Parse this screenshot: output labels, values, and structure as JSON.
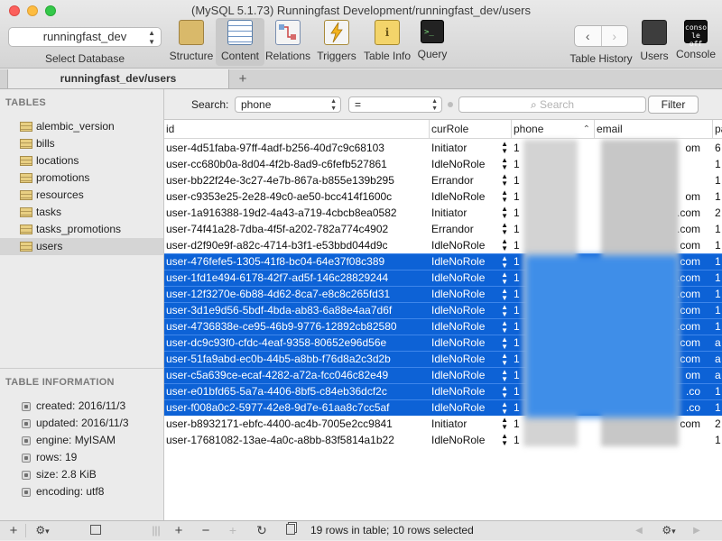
{
  "window": {
    "title": "(MySQL 5.1.73) Runningfast Development/runningfast_dev/users"
  },
  "toolbar": {
    "database": "runningfast_dev",
    "database_label": "Select Database",
    "structure": "Structure",
    "content": "Content",
    "relations": "Relations",
    "triggers": "Triggers",
    "table_info": "Table Info",
    "query": "Query",
    "table_history": "Table History",
    "users": "Users",
    "console": "Console",
    "console_icon_text": "conso le off",
    "query_icon_text": ">_"
  },
  "tab": {
    "label": "runningfast_dev/users",
    "add": "+"
  },
  "sidebar": {
    "tables_header": "TABLES",
    "tables": [
      "alembic_version",
      "bills",
      "locations",
      "promotions",
      "resources",
      "tasks",
      "tasks_promotions",
      "users"
    ],
    "info_header": "TABLE INFORMATION",
    "info": [
      "created: 2016/11/3",
      "updated: 2016/11/3",
      "engine: MyISAM",
      "rows: 19",
      "size: 2.8 KiB",
      "encoding: utf8"
    ]
  },
  "filter": {
    "search_label": "Search:",
    "field": "phone",
    "operator": "=",
    "search_placeholder": "Search",
    "filter_button": "Filter"
  },
  "table": {
    "columns": [
      "id",
      "curRole",
      "phone",
      "email",
      "pa"
    ],
    "rows": [
      {
        "id": "user-4d51faba-97ff-4adf-b256-40d7c9c68103",
        "role": "Initiator",
        "phone": "1",
        "email": "om",
        "pa": "6",
        "selected": false
      },
      {
        "id": "user-cc680b0a-8d04-4f2b-8ad9-c6fefb527861",
        "role": "IdleNoRole",
        "phone": "1",
        "email": "",
        "pa": "1",
        "selected": false
      },
      {
        "id": "user-bb22f24e-3c27-4e7b-867a-b855e139b295",
        "role": "Errandor",
        "phone": "1",
        "email": "",
        "pa": "1",
        "selected": false
      },
      {
        "id": "user-c9353e25-2e28-49c0-ae50-bcc414f1600c",
        "role": "IdleNoRole",
        "phone": "1",
        "email": "om",
        "pa": "1",
        "selected": false
      },
      {
        "id": "user-1a916388-19d2-4a43-a719-4cbcb8ea0582",
        "role": "Initiator",
        "phone": "1",
        "email": ".com",
        "pa": "2",
        "selected": false
      },
      {
        "id": "user-74f41a28-7dba-4f5f-a202-782a774c4902",
        "role": "Errandor",
        "phone": "1",
        "email": ".com",
        "pa": "1",
        "selected": false
      },
      {
        "id": "user-d2f90e9f-a82c-4714-b3f1-e53bbd044d9c",
        "role": "IdleNoRole",
        "phone": "1",
        "email": "com",
        "pa": "1",
        "selected": false
      },
      {
        "id": "user-476fefe5-1305-41f8-bc04-64e37f08c389",
        "role": "IdleNoRole",
        "phone": "1",
        "email": "com",
        "pa": "1",
        "selected": true
      },
      {
        "id": "user-1fd1e494-6178-42f7-ad5f-146c28829244",
        "role": "IdleNoRole",
        "phone": "1",
        "email": ".com",
        "pa": "1",
        "selected": true
      },
      {
        "id": "user-12f3270e-6b88-4d62-8ca7-e8c8c265fd31",
        "role": "IdleNoRole",
        "phone": "1",
        "email": ".com",
        "pa": "1",
        "selected": true
      },
      {
        "id": "user-3d1e9d56-5bdf-4bda-ab83-6a88e4aa7d6f",
        "role": "IdleNoRole",
        "phone": "1",
        "email": "com",
        "pa": "1",
        "selected": true
      },
      {
        "id": "user-4736838e-ce95-46b9-9776-12892cb82580",
        "role": "IdleNoRole",
        "phone": "1",
        "email": ".com",
        "pa": "1",
        "selected": true
      },
      {
        "id": "user-dc9c93f0-cfdc-4eaf-9358-80652e96d56e",
        "role": "IdleNoRole",
        "phone": "1",
        "email": "com",
        "pa": "a",
        "selected": true
      },
      {
        "id": "user-51fa9abd-ec0b-44b5-a8bb-f76d8a2c3d2b",
        "role": "IdleNoRole",
        "phone": "1",
        "email": "com",
        "pa": "a",
        "selected": true
      },
      {
        "id": "user-c5a639ce-ecaf-4282-a72a-fcc046c82e49",
        "role": "IdleNoRole",
        "phone": "1",
        "email": "om",
        "pa": "a",
        "selected": true
      },
      {
        "id": "user-e01bfd65-5a7a-4406-8bf5-c84eb36dcf2c",
        "role": "IdleNoRole",
        "phone": "1",
        "email": ".co",
        "pa": "1",
        "selected": true
      },
      {
        "id": "user-f008a0c2-5977-42e8-9d7e-61aa8c7cc5af",
        "role": "IdleNoRole",
        "phone": "1",
        "email": ".co",
        "pa": "1",
        "selected": true
      },
      {
        "id": "user-b8932171-ebfc-4400-ac4b-7005e2cc9841",
        "role": "Initiator",
        "phone": "1",
        "email": "com",
        "pa": "2",
        "selected": false
      },
      {
        "id": "user-17681082-13ae-4a0c-a8bb-83f5814a1b22",
        "role": "IdleNoRole",
        "phone": "1",
        "email": "",
        "pa": "1",
        "selected": false
      }
    ]
  },
  "statusbar": {
    "text": "19 rows in table; 10 rows selected"
  },
  "colors": {
    "selection": "#0d62d6",
    "sidebar_selected": "#d5d5d5"
  },
  "icons": {
    "add": "+",
    "remove": "−",
    "refresh": "↻",
    "gear": "⚙",
    "chevron_down": "▾",
    "back": "‹",
    "forward": "›",
    "play_left": "◀",
    "play_right": "▶",
    "search": "⌕",
    "sort_up": "⌃"
  }
}
